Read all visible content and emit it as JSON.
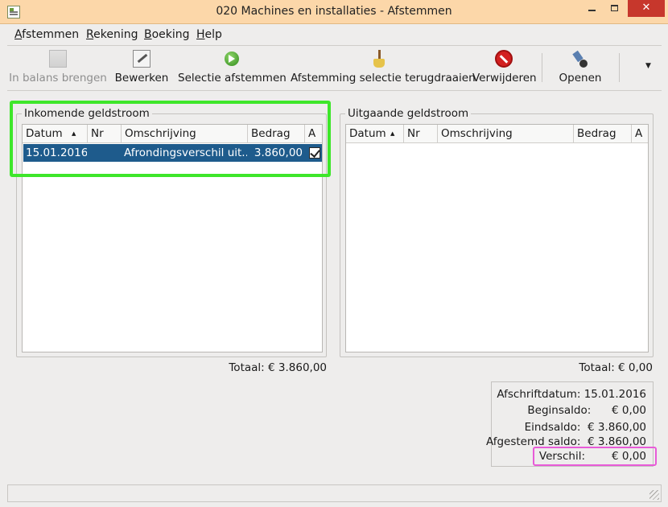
{
  "window": {
    "title": "020 Machines en installaties - Afstemmen"
  },
  "menu": [
    "Afstemmen",
    "Rekening",
    "Boeking",
    "Help"
  ],
  "toolbar": {
    "balance": "In balans brengen",
    "edit": "Bewerken",
    "select": "Selectie afstemmen",
    "undo": "Afstemming selectie terugdraaien",
    "delete": "Verwijderen",
    "open": "Openen"
  },
  "incoming": {
    "title": "Inkomende geldstroom",
    "columns": [
      "Datum",
      "Nr",
      "Omschrijving",
      "Bedrag",
      "A"
    ],
    "rows": [
      {
        "datum": "15.01.2016",
        "nr": "",
        "omschrijving": "Afrondingsverschil uit...",
        "bedrag": "3.860,00",
        "checked": true
      }
    ],
    "total": "Totaal: € 3.860,00"
  },
  "outgoing": {
    "title": "Uitgaande geldstroom",
    "columns": [
      "Datum",
      "Nr",
      "Omschrijving",
      "Bedrag",
      "A"
    ],
    "rows": [],
    "total": "Totaal: € 0,00"
  },
  "summary": {
    "afschriftdatum": "Afschriftdatum: 15.01.2016",
    "beginsaldo": "Beginsaldo:      € 0,00",
    "eindsaldo": "Eindsaldo:  € 3.860,00",
    "afgestemd": "Afgestemd saldo:  € 3.860,00",
    "verschil_label": "Verschil:",
    "verschil_value": "€ 0,00"
  }
}
